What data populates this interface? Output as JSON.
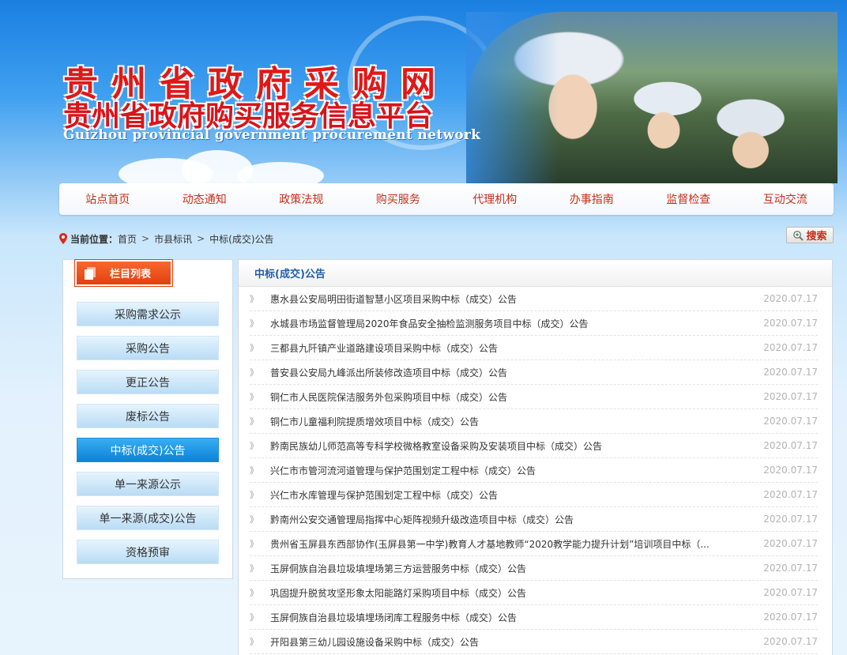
{
  "banner": {
    "title_main": "贵州省政府采购网",
    "title_sub": "贵州省政府购买服务信息平台",
    "title_en": "Guizhou provincial government procurement network"
  },
  "nav": {
    "items": [
      "站点首页",
      "动态通知",
      "政策法规",
      "购买服务",
      "代理机构",
      "办事指南",
      "监督检查",
      "互动交流"
    ]
  },
  "breadcrumb": {
    "label": "当前位置：",
    "items": [
      "首页",
      "市县标讯",
      "中标(成交)公告"
    ],
    "separator": ">"
  },
  "search": {
    "label": "搜索",
    "icon": "zoom-icon"
  },
  "sidebar": {
    "header": "栏目列表",
    "header_icon": "document-icon",
    "items": [
      "采购需求公示",
      "采购公告",
      "更正公告",
      "废标公告",
      "中标(成交)公告",
      "单一来源公示",
      "单一来源(成交)公告",
      "资格预审"
    ],
    "active_item": "中标(成交)公告"
  },
  "main": {
    "title": "中标(成交)公告",
    "row_icon": "》",
    "rows": [
      {
        "title": "惠水县公安局明田街道智慧小区项目采购中标（成交）公告",
        "date": "2020.07.17"
      },
      {
        "title": "水城县市场监督管理局2020年食品安全抽检监测服务项目中标（成交）公告",
        "date": "2020.07.17"
      },
      {
        "title": "三都县九阡镇产业道路建设项目采购中标（成交）公告",
        "date": "2020.07.17"
      },
      {
        "title": "普安县公安局九峰派出所装修改造项目中标（成交）公告",
        "date": "2020.07.17"
      },
      {
        "title": "铜仁市人民医院保洁服务外包采购项目中标（成交）公告",
        "date": "2020.07.17"
      },
      {
        "title": "铜仁市儿童福利院提质增效项目中标（成交）公告",
        "date": "2020.07.17"
      },
      {
        "title": "黔南民族幼儿师范高等专科学校微格教室设备采购及安装项目中标（成交）公告",
        "date": "2020.07.17"
      },
      {
        "title": "兴仁市市管河流河道管理与保护范围划定工程中标（成交）公告",
        "date": "2020.07.17"
      },
      {
        "title": "兴仁市水库管理与保护范围划定工程中标（成交）公告",
        "date": "2020.07.17"
      },
      {
        "title": "黔南州公安交通管理局指挥中心矩阵视频升级改造项目中标（成交）公告",
        "date": "2020.07.17"
      },
      {
        "title": "贵州省玉屏县东西部协作(玉屏县第一中学)教育人才基地教师“2020教学能力提升计划”培训项目中标（...",
        "date": "2020.07.17"
      },
      {
        "title": "玉屏侗族自治县垃圾填埋场第三方运营服务中标（成交）公告",
        "date": "2020.07.17"
      },
      {
        "title": "巩固提升脱贫攻坚形象太阳能路灯采购项目中标（成交）公告",
        "date": "2020.07.17"
      },
      {
        "title": "玉屏侗族自治县垃圾填埋场闭库工程服务中标（成交）公告",
        "date": "2020.07.17"
      },
      {
        "title": "开阳县第三幼儿园设施设备采购中标（成交）公告",
        "date": "2020.07.17"
      }
    ]
  },
  "colors": {
    "brand_red": "#e01818",
    "nav_text": "#c5301a",
    "sidebar_header": "#e2400f",
    "active_blue": "#0a83d8",
    "list_title": "#1f5fa8",
    "date_gray": "#b3b3b3"
  }
}
